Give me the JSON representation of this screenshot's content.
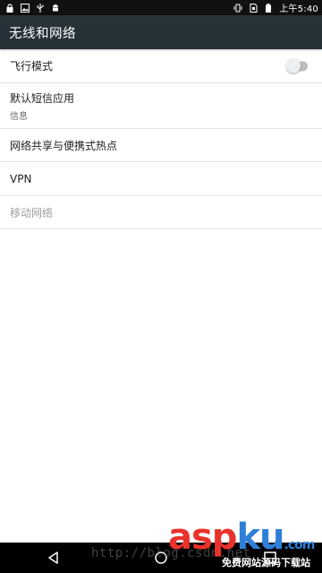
{
  "status_bar": {
    "time": "上午5:40",
    "left_icons": [
      "lock-icon",
      "image-icon",
      "usb-icon",
      "android-icon"
    ],
    "right_icons": [
      "vibrate-icon",
      "sim-icon",
      "battery-icon"
    ]
  },
  "app_bar": {
    "title": "无线和网络"
  },
  "settings": {
    "airplane": {
      "title": "飞行模式",
      "enabled": false
    },
    "default_sms": {
      "title": "默认短信应用",
      "summary": "信息"
    },
    "tethering": {
      "title": "网络共享与便携式热点"
    },
    "vpn": {
      "title": "VPN"
    },
    "mobile_network": {
      "title": "移动网络"
    }
  },
  "watermark": {
    "url": "http://blog.csdn.net",
    "logo": {
      "part1": "asp",
      "part2": "ku",
      "part3": ".com"
    },
    "caption": "免费网站源码下载站"
  },
  "colors": {
    "app_bar": "#263238",
    "status_bar": "#111111",
    "divider": "#e3e3e3",
    "logo_red": "#e8322b",
    "logo_blue": "#2e7fd6"
  }
}
